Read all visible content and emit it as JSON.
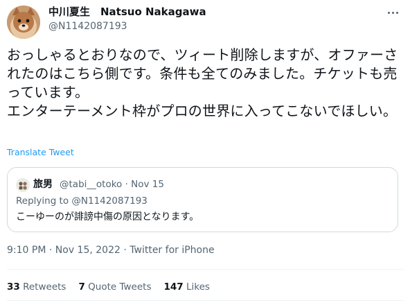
{
  "author": {
    "name": "中川夏生　Natsuo Nakagawa",
    "handle": "@N1142087193"
  },
  "tweet": {
    "text": "おっしゃるとおりなので、ツィート削除しますが、オファーされたのはこちら側です。条件も全てのみました。チケットも売っています。\nエンターテーメント枠がプロの世界に入ってこないでほしい。",
    "translate_label": "Translate Tweet"
  },
  "quoted": {
    "name": "旅男",
    "handle_line": "@tabi__otoko · Nov 15",
    "reply_prefix": "Replying to",
    "reply_to": "@N1142087193",
    "text": "こーゆーのが誹謗中傷の原因となります。"
  },
  "meta": {
    "time": "9:10 PM",
    "sep1": " · ",
    "date": "Nov 15, 2022",
    "sep2": " · ",
    "source": "Twitter for iPhone"
  },
  "stats": {
    "retweets_count": "33",
    "retweets_label": "Retweets",
    "quotes_count": "7",
    "quotes_label": "Quote Tweets",
    "likes_count": "147",
    "likes_label": "Likes"
  },
  "colors": {
    "link": "#1d9bf0",
    "secondary": "#536471",
    "border": "#cfd9de"
  },
  "icons": {
    "more": "more-horizontal-icon"
  }
}
